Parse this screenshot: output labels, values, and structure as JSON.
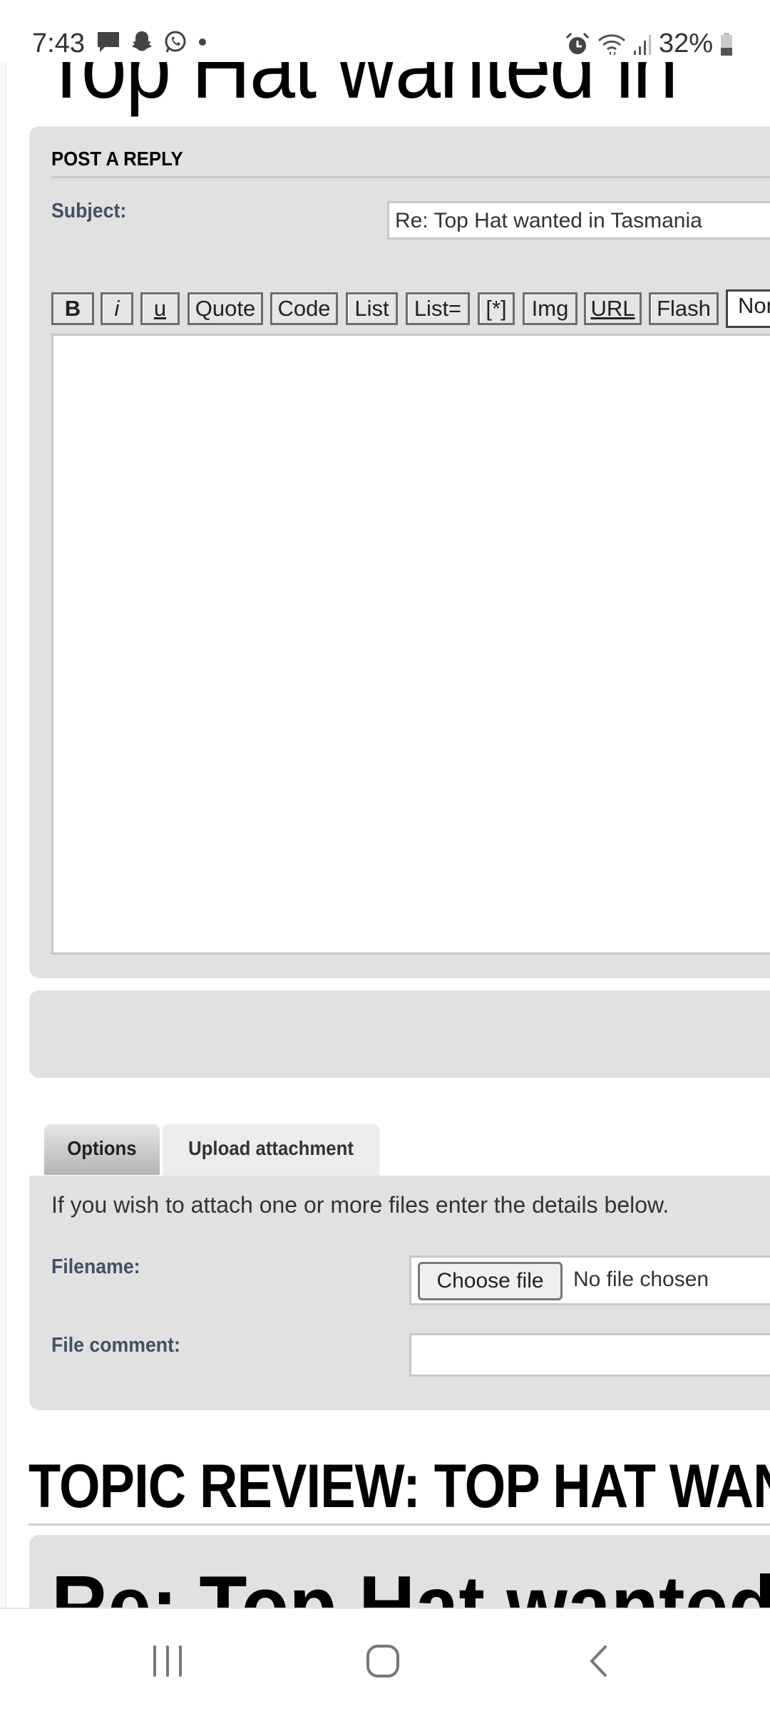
{
  "status_bar": {
    "time": "7:43",
    "battery": "32%",
    "icons_left": [
      "message-icon",
      "snapchat-icon",
      "whatsapp-icon",
      "dot-icon"
    ],
    "icons_right": [
      "alarm-icon",
      "wifi-icon",
      "signal-icon",
      "battery-icon"
    ]
  },
  "page": {
    "title": "Top Hat wanted in"
  },
  "post_reply": {
    "heading": "POST A REPLY",
    "subject_label": "Subject:",
    "subject_value": "Re: Top Hat wanted in Tasmania",
    "toolbar": [
      "B",
      "i",
      "u",
      "Quote",
      "Code",
      "List",
      "List=",
      "[*]",
      "Img",
      "URL",
      "Flash"
    ],
    "font_select": "Normal",
    "message_value": ""
  },
  "tabs": [
    {
      "label": "Options"
    },
    {
      "label": "Upload attachment",
      "active": true
    }
  ],
  "attachment": {
    "info": "If you wish to attach one or more files enter the details below.",
    "filename_label": "Filename:",
    "choose_file": "Choose file",
    "no_file": "No file chosen",
    "comment_label": "File comment:",
    "comment_value": ""
  },
  "topic_review": {
    "heading": "TOPIC REVIEW: TOP HAT WANTED IN TASMANIA",
    "first_post_title": "Re: Top Hat wanted in Tasmania"
  },
  "colors": {
    "panel": "#e1e1e1",
    "label": "#425067"
  }
}
